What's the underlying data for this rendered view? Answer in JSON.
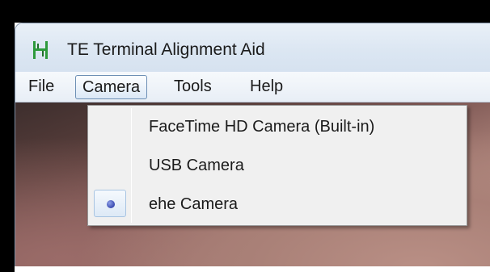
{
  "window": {
    "title": "TE Terminal Alignment Aid",
    "icon": "app-logo-icon"
  },
  "menubar": {
    "items": [
      {
        "label": "File"
      },
      {
        "label": "Camera",
        "active": true
      },
      {
        "label": "Tools"
      },
      {
        "label": "Help"
      }
    ]
  },
  "camera_menu": {
    "items": [
      {
        "label": "FaceTime HD Camera (Built-in)",
        "selected": false
      },
      {
        "label": "USB Camera",
        "selected": false
      },
      {
        "label": "ehe Camera",
        "selected": true
      }
    ],
    "selected_indicator": "radio-dot-icon"
  },
  "colors": {
    "accent": "#6d8fb5",
    "radio": "#3a4ab0",
    "app_icon_green": "#2e9a3c"
  }
}
